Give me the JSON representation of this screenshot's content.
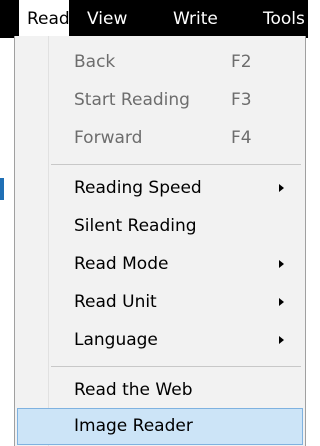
{
  "menubar": {
    "items": [
      {
        "label": "Read"
      },
      {
        "label": "View"
      },
      {
        "label": "Write"
      },
      {
        "label": "Tools"
      }
    ]
  },
  "menu": {
    "group1": [
      {
        "label": "Back",
        "shortcut": "F2",
        "enabled": false
      },
      {
        "label": "Start Reading",
        "shortcut": "F3",
        "enabled": false
      },
      {
        "label": "Forward",
        "shortcut": "F4",
        "enabled": false
      }
    ],
    "group2": [
      {
        "label": "Reading Speed",
        "submenu": true
      },
      {
        "label": "Silent Reading",
        "submenu": false
      },
      {
        "label": "Read Mode",
        "submenu": true
      },
      {
        "label": "Read Unit",
        "submenu": true
      },
      {
        "label": "Language",
        "submenu": true
      }
    ],
    "group3": [
      {
        "label": "Read the Web"
      },
      {
        "label": "Image Reader",
        "highlighted": true
      }
    ]
  },
  "colors": {
    "menubar_bg": "#000000",
    "menu_bg": "#f2f2f2",
    "highlight_bg": "#cce4f7",
    "disabled_text": "#6d6d6d"
  }
}
